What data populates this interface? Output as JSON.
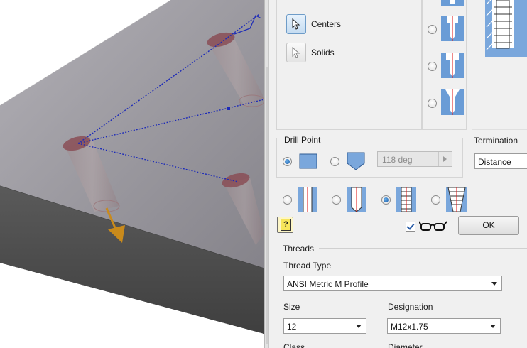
{
  "selection": {
    "centers_label": "Centers",
    "solids_label": "Solids",
    "centers_icon": "select-arrow-icon",
    "solids_icon": "select-arrow-icon"
  },
  "drill_point": {
    "title": "Drill Point",
    "options": [
      "flat-drill-point-icon",
      "angled-drill-point-icon"
    ],
    "selected": 0,
    "angle_value": "118 deg"
  },
  "termination": {
    "title": "Termination",
    "value": "Distance"
  },
  "hole_type": {
    "options": [
      "simple-hole-icon",
      "clearance-hole-icon",
      "tapped-hole-icon",
      "taper-tapped-hole-icon"
    ],
    "selected": 2
  },
  "preview_checkbox": {
    "checked": true,
    "icon": "glasses-icon"
  },
  "ok_label": "OK",
  "help_icon": "help-icon",
  "threads": {
    "group_title": "Threads",
    "type_label": "Thread Type",
    "type_value": "ANSI Metric M Profile",
    "size_label": "Size",
    "size_value": "12",
    "designation_label": "Designation",
    "designation_value": "M12x1.75",
    "class_label": "Class",
    "diameter_label": "Diameter"
  },
  "colors": {
    "dialog_bg": "#f0f0f0",
    "viewport_face_top": "#8e8c93",
    "viewport_face_side": "#4c4c4c",
    "hole_fill": "#b79b9c",
    "hole_top": "#8a4e56",
    "sketch_line": "#1d2bb8",
    "direction_arrow": "#c98a1b",
    "selected_radio": "#1a5aa6"
  }
}
